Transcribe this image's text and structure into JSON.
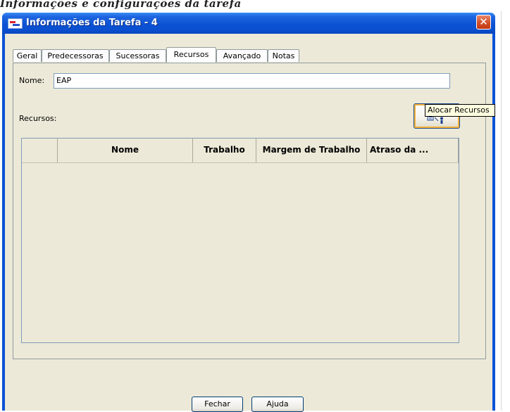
{
  "background_caption": "Informações e configurações da tarefa",
  "window": {
    "title": "Informações da Tarefa - 4",
    "close_glyph": "✕"
  },
  "tabs": [
    {
      "label": "Geral",
      "active": false
    },
    {
      "label": "Predecessoras",
      "active": false
    },
    {
      "label": "Sucessoras",
      "active": false
    },
    {
      "label": "Recursos",
      "active": true
    },
    {
      "label": "Avançado",
      "active": false
    },
    {
      "label": "Notas",
      "active": false
    }
  ],
  "form": {
    "name_label": "Nome:",
    "name_value": "EAP",
    "resources_label": "Recursos:"
  },
  "assign_button": {
    "icon": "assign-resources-icon",
    "tooltip": "Alocar Recursos"
  },
  "table": {
    "columns": [
      "",
      "Nome",
      "Trabalho",
      "Margem de Trabalho",
      "Atraso da ..."
    ],
    "rows": []
  },
  "scrollbar": {
    "left_glyph": "<",
    "right_glyph": ">"
  },
  "footer": {
    "close_label": "Fechar",
    "help_label": "Ajuda"
  },
  "colors": {
    "titlebar": "#0a52d6",
    "client": "#ece9d8",
    "close_button": "#d04a22",
    "focus_ring": "#f7b13a",
    "tooltip": "#ffffe1"
  }
}
